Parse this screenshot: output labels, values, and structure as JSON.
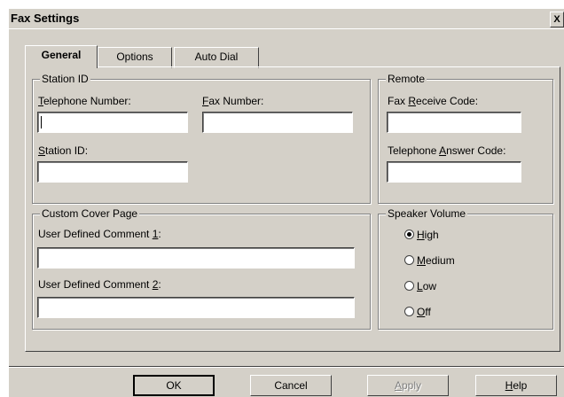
{
  "window": {
    "title": "Fax Settings",
    "close_label": "X"
  },
  "tabs": [
    {
      "label": "General",
      "active": true
    },
    {
      "label": "Options",
      "active": false
    },
    {
      "label": "Auto Dial",
      "active": false
    }
  ],
  "station_id": {
    "legend": "Station ID",
    "telephone_number": {
      "label_ul": "T",
      "label_rest": "elephone Number:",
      "value": ""
    },
    "fax_number": {
      "label_ul": "F",
      "label_rest": "ax Number:",
      "value": ""
    },
    "station_id": {
      "label_ul": "S",
      "label_rest": "tation ID:",
      "value": ""
    }
  },
  "remote": {
    "legend": "Remote",
    "fax_receive_code": {
      "label_pre": "Fax ",
      "label_ul": "R",
      "label_rest": "eceive Code:",
      "value": ""
    },
    "telephone_answer_code": {
      "label_pre": "Telephone ",
      "label_ul": "A",
      "label_rest": "nswer Code:",
      "value": ""
    }
  },
  "cover_page": {
    "legend": "Custom Cover Page",
    "comment1": {
      "label_pre": "User Defined Comment ",
      "label_ul": "1",
      "label_rest": ":",
      "value": ""
    },
    "comment2": {
      "label_pre": "User Defined Comment ",
      "label_ul": "2",
      "label_rest": ":",
      "value": ""
    }
  },
  "speaker_volume": {
    "legend": "Speaker Volume",
    "options": [
      {
        "ul": "H",
        "rest": "igh",
        "selected": true
      },
      {
        "ul": "M",
        "rest": "edium",
        "selected": false
      },
      {
        "ul": "L",
        "rest": "ow",
        "selected": false
      },
      {
        "ul": "O",
        "rest": "ff",
        "selected": false
      }
    ]
  },
  "buttons": {
    "ok": "OK",
    "cancel": "Cancel",
    "apply_ul": "A",
    "apply_rest": "pply",
    "help_ul": "H",
    "help_rest": "elp"
  },
  "colors": {
    "face": "#d4d0c8",
    "shadow": "#404040",
    "highlight": "#ffffff"
  }
}
